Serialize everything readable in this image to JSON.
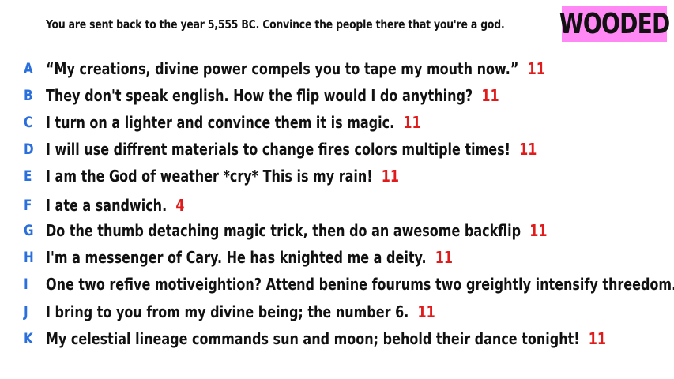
{
  "prompt": "You are sent back to the year 5,555 BC. Convince the people there that you're a god.",
  "badge": "WOODED",
  "colors": {
    "badge_bg": "#ff88f5",
    "letter": "#2a6fdb",
    "score": "#e01b1b",
    "text": "#111111"
  },
  "answers": [
    {
      "letter": "A",
      "text": "“My creations, divine power compels you to tape my mouth now.”",
      "score": "11"
    },
    {
      "letter": "B",
      "text": "They don't speak english. How the flip would I do anything?",
      "score": "11"
    },
    {
      "letter": "C",
      "text": "I turn on a lighter and convince them it is magic.",
      "score": "11"
    },
    {
      "letter": "D",
      "text": "I will use diffrent materials to change fires colors multiple times!",
      "score": "11"
    },
    {
      "letter": "E",
      "text": "I am the God of weather *cry* This is my rain!",
      "score": "11"
    },
    {
      "letter": "F",
      "text": "I ate a sandwich.",
      "score": "4"
    },
    {
      "letter": "G",
      "text": "Do the thumb detaching magic trick, then do an awesome backflip",
      "score": "11"
    },
    {
      "letter": "H",
      "text": "I'm a messenger of Cary. He has knighted me a deity.",
      "score": "11"
    },
    {
      "letter": "I",
      "text": "One two refive motiveightion? Attend benine fourums two greightly intensify threedom.",
      "score": "11"
    },
    {
      "letter": "J",
      "text": "I bring to you from my divine being; the number 6.",
      "score": "11"
    },
    {
      "letter": "K",
      "text": "My celestial lineage commands sun and moon; behold their dance tonight!",
      "score": "11"
    }
  ]
}
